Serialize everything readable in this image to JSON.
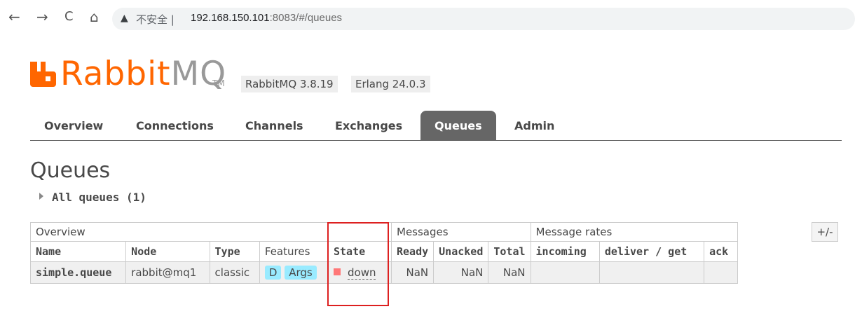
{
  "browser": {
    "back_icon": "←",
    "forward_icon": "→",
    "reload_icon": "C",
    "home_icon": "⌂",
    "warn_icon": "▲",
    "security_label": "不安全 |",
    "url_host": "192.168.150.101",
    "url_rest": ":8083/#/queues"
  },
  "brand": {
    "name_main": "Rabbit",
    "name_mq": "MQ",
    "tm": "TM",
    "version": "RabbitMQ 3.8.19",
    "erlang": "Erlang 24.0.3",
    "color": "#ff6600"
  },
  "tabs": [
    "Overview",
    "Connections",
    "Channels",
    "Exchanges",
    "Queues",
    "Admin"
  ],
  "active_tab": "Queues",
  "page": {
    "title": "Queues",
    "section": "All queues (1)"
  },
  "table": {
    "groups": [
      "Overview",
      "Messages",
      "Message rates"
    ],
    "columns": [
      "Name",
      "Node",
      "Type",
      "Features",
      "State",
      "Ready",
      "Unacked",
      "Total",
      "incoming",
      "deliver / get",
      "ack"
    ],
    "rows": [
      {
        "name": "simple.queue",
        "node": "rabbit@mq1",
        "type": "classic",
        "features": [
          "D",
          "Args"
        ],
        "state": "down",
        "ready": "NaN",
        "unacked": "NaN",
        "total": "NaN",
        "incoming": "",
        "deliver_get": "",
        "ack": ""
      }
    ],
    "toggle_label": "+/-"
  }
}
